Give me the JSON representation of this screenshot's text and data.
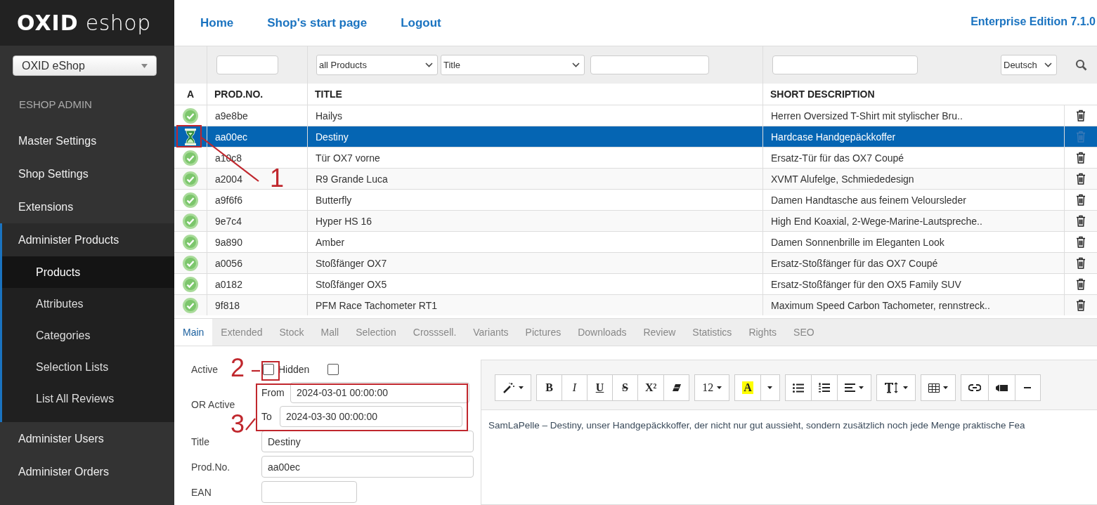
{
  "logo": {
    "brand": "OXID",
    "product": "eshop"
  },
  "shop_select": {
    "value": "OXID eShop"
  },
  "sidebar": {
    "heading": "ESHOP ADMIN",
    "items": [
      {
        "label": "Master Settings",
        "expanded": false
      },
      {
        "label": "Shop Settings",
        "expanded": false
      },
      {
        "label": "Extensions",
        "expanded": false
      },
      {
        "label": "Administer Products",
        "expanded": true,
        "children": [
          {
            "label": "Products",
            "selected": true
          },
          {
            "label": "Attributes",
            "selected": false
          },
          {
            "label": "Categories",
            "selected": false
          },
          {
            "label": "Selection Lists",
            "selected": false
          },
          {
            "label": "List All Reviews",
            "selected": false
          }
        ]
      },
      {
        "label": "Administer Users",
        "expanded": false
      },
      {
        "label": "Administer Orders",
        "expanded": false
      }
    ]
  },
  "top_nav": {
    "links": [
      "Home",
      "Shop's start page",
      "Logout"
    ],
    "edition": "Enterprise Edition 7.1.0"
  },
  "filters": {
    "product_filter": "all Products",
    "field_filter": "Title",
    "language": "Deutsch"
  },
  "table": {
    "columns": [
      "A",
      "PROD.NO.",
      "TITLE",
      "SHORT DESCRIPTION"
    ],
    "rows": [
      {
        "kind": "active",
        "prod_no": "a9e8be",
        "title": "Hailys",
        "short_description": "Herren Oversized T-Shirt mit stylischer Bru..",
        "selected": false
      },
      {
        "kind": "scheduled",
        "prod_no": "aa00ec",
        "title": "Destiny",
        "short_description": "Hardcase Handgepäckkoffer",
        "selected": true
      },
      {
        "kind": "active",
        "prod_no": "a10c8",
        "title": "Tür OX7 vorne",
        "short_description": "Ersatz-Tür für das OX7 Coupé",
        "selected": false
      },
      {
        "kind": "active",
        "prod_no": "a2004",
        "title": "R9 Grande Luca",
        "short_description": "XVMT Alufelge, Schmiededesign",
        "selected": false
      },
      {
        "kind": "active",
        "prod_no": "a9f6f6",
        "title": "Butterfly",
        "short_description": "Damen Handtasche aus feinem Veloursleder",
        "selected": false
      },
      {
        "kind": "active",
        "prod_no": "9e7c4",
        "title": "Hyper HS 16",
        "short_description": "High End Koaxial, 2-Wege-Marine-Lautspreche..",
        "selected": false
      },
      {
        "kind": "active",
        "prod_no": "9a890",
        "title": "Amber",
        "short_description": "Damen Sonnenbrille im Eleganten Look",
        "selected": false
      },
      {
        "kind": "active",
        "prod_no": "a0056",
        "title": "Stoßfänger OX7",
        "short_description": "Ersatz-Stoßfänger für das OX7 Coupé",
        "selected": false
      },
      {
        "kind": "active",
        "prod_no": "a0182",
        "title": "Stoßfänger OX5",
        "short_description": "Ersatz-Stoßfänger für den OX5 Family SUV",
        "selected": false
      },
      {
        "kind": "active",
        "prod_no": "9f818",
        "title": "PFM Race Tachometer RT1",
        "short_description": "Maximum Speed Carbon Tachometer, rennstreck..",
        "selected": false
      }
    ]
  },
  "tabs": [
    {
      "label": "Main",
      "selected": true
    },
    {
      "label": "Extended",
      "selected": false
    },
    {
      "label": "Stock",
      "selected": false
    },
    {
      "label": "Mall",
      "selected": false
    },
    {
      "label": "Selection",
      "selected": false
    },
    {
      "label": "Crosssell.",
      "selected": false
    },
    {
      "label": "Variants",
      "selected": false
    },
    {
      "label": "Pictures",
      "selected": false
    },
    {
      "label": "Downloads",
      "selected": false
    },
    {
      "label": "Review",
      "selected": false
    },
    {
      "label": "Statistics",
      "selected": false
    },
    {
      "label": "Rights",
      "selected": false
    },
    {
      "label": "SEO",
      "selected": false
    }
  ],
  "form": {
    "active": {
      "label": "Active",
      "checked": false
    },
    "hidden": {
      "label": "Hidden",
      "checked": false
    },
    "or_active": {
      "label": "OR Active",
      "from_label": "From",
      "from": "2024-03-01 00:00:00",
      "to_label": "To",
      "to": "2024-03-30 00:00:00"
    },
    "title": {
      "label": "Title",
      "value": "Destiny"
    },
    "prod_no": {
      "label": "Prod.No.",
      "value": "aa00ec"
    },
    "ean": {
      "label": "EAN"
    }
  },
  "editor": {
    "toolbar": [
      [
        {
          "kind": "wand",
          "caret": true
        }
      ],
      [
        {
          "kind": "bold",
          "label": "B"
        },
        {
          "kind": "italic",
          "label": "I"
        },
        {
          "kind": "underline",
          "label": "U"
        },
        {
          "kind": "strike",
          "label": "S"
        },
        {
          "kind": "bold",
          "label": "X²"
        },
        {
          "kind": "eraser"
        }
      ],
      [
        {
          "kind": "plain",
          "label": "12",
          "caret": true
        }
      ],
      [
        {
          "kind": "highlight",
          "label": "A"
        },
        {
          "kind": "dropdown",
          "caret": true
        }
      ],
      [
        {
          "kind": "bullet-list"
        },
        {
          "kind": "numbered-list"
        },
        {
          "kind": "align",
          "caret": true
        }
      ],
      [
        {
          "kind": "text-height",
          "caret": true
        }
      ],
      [
        {
          "kind": "table",
          "caret": true
        }
      ],
      [
        {
          "kind": "link"
        },
        {
          "kind": "video"
        },
        {
          "kind": "rule"
        }
      ]
    ],
    "content": "SamLaPelle – Destiny, unser Handgepäckkoffer, der nicht nur gut aussieht, sondern zusätzlich noch jede Menge praktische Fea"
  },
  "callouts": [
    {
      "label": "1"
    },
    {
      "label": "2"
    },
    {
      "label": "3"
    }
  ]
}
